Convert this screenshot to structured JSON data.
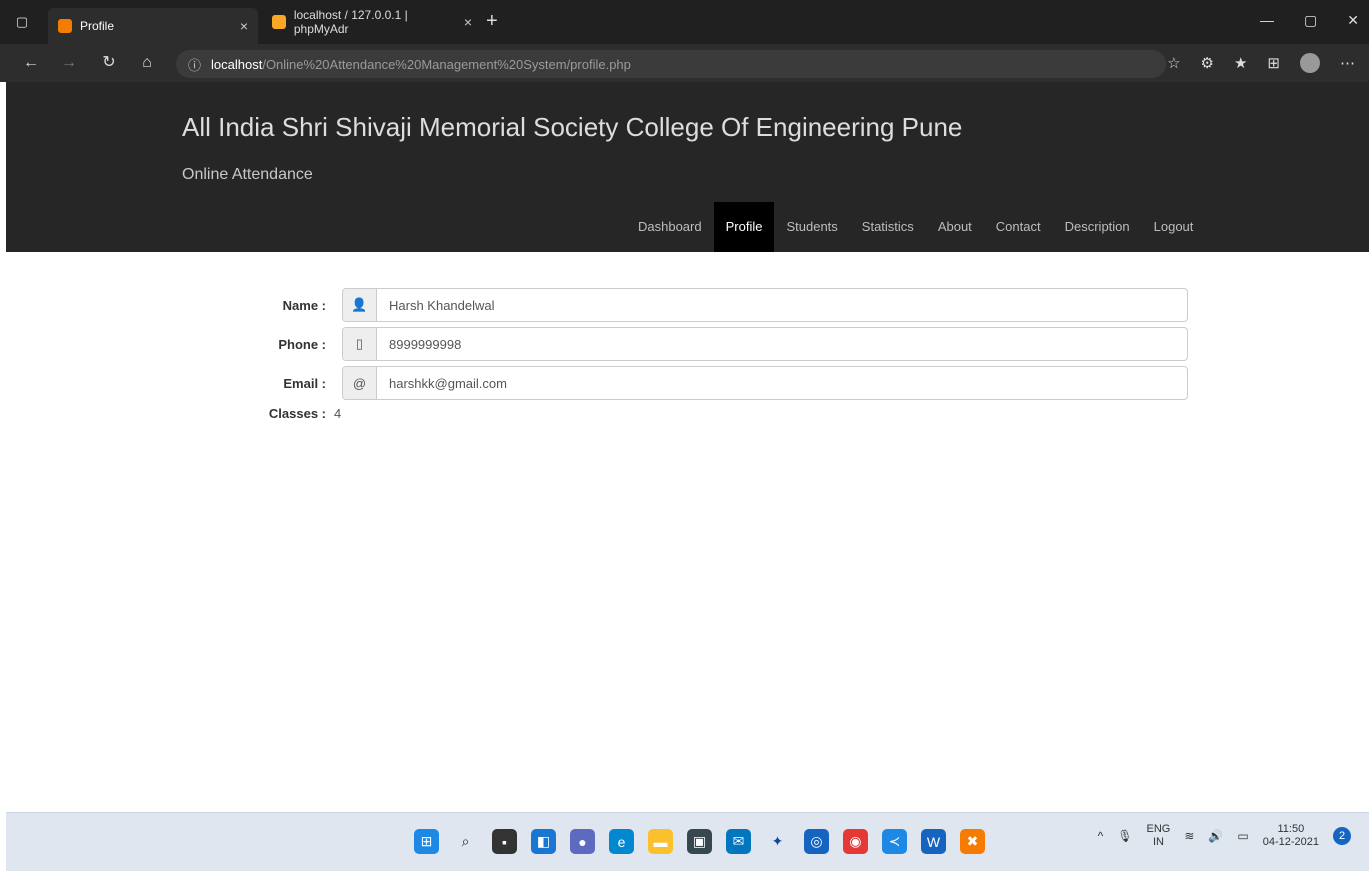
{
  "browser": {
    "tabs": [
      {
        "title": "Profile",
        "close": "×"
      },
      {
        "title": "localhost / 127.0.0.1 | phpMyAdr",
        "close": "×"
      }
    ],
    "new_tab": "+",
    "url_info": "ⓘ",
    "url_host": "localhost",
    "url_path": "/Online%20Attendance%20Management%20System/profile.php",
    "window_controls": [
      "—",
      "▢",
      "✕"
    ]
  },
  "site": {
    "title": "All India Shri Shivaji Memorial Society College Of Engineering Pune",
    "subtitle": "Online Attendance",
    "nav": [
      "Dashboard",
      "Profile",
      "Students",
      "Statistics",
      "About",
      "Contact",
      "Description",
      "Logout"
    ],
    "active_nav": "Profile"
  },
  "profile": {
    "name_label": "Name :",
    "name_value": "Harsh Khandelwal",
    "phone_label": "Phone :",
    "phone_value": "8999999998",
    "email_label": "Email :",
    "email_value": "harshkk@gmail.com",
    "classes_label": "Classes :",
    "classes_value": "4"
  },
  "taskbar": {
    "lang_top": "ENG",
    "lang_bottom": "IN",
    "time": "11:50",
    "date": "04-12-2021",
    "notifications": "2"
  },
  "colors": {
    "header_bg": "#262626",
    "nav_active_bg": "#000000",
    "browser_bg": "#202020"
  }
}
